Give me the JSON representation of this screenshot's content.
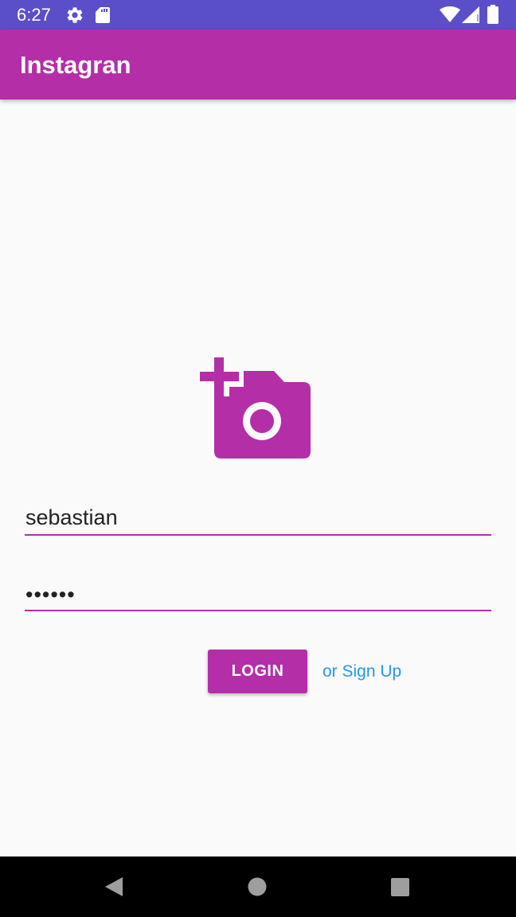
{
  "status_bar": {
    "time": "6:27",
    "icons": [
      "settings-gear-icon",
      "sd-card-icon",
      "wifi-icon",
      "cellular-signal-icon",
      "battery-icon"
    ],
    "background": "#5b4fc9"
  },
  "app_bar": {
    "title": "Instagran",
    "background": "#b42ea8"
  },
  "logo": {
    "icon": "add-a-photo-icon",
    "color": "#b42ea8"
  },
  "login_form": {
    "username_value": "sebastian",
    "password_value": "••••••",
    "login_label": "LOGIN",
    "signup_label": "or Sign Up",
    "accent": "#b42ea8",
    "link_color": "#2196f3"
  },
  "nav_bar": {
    "buttons": [
      "back-icon",
      "home-icon",
      "recents-icon"
    ]
  }
}
